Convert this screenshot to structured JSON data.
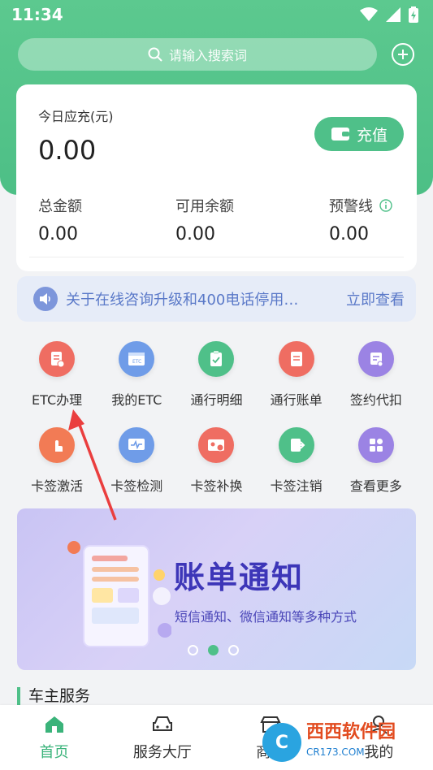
{
  "status": {
    "time": "11:34"
  },
  "search": {
    "placeholder": "请输入搜索词"
  },
  "balance_card": {
    "today_label": "今日应充(元)",
    "today_amount": "0.00",
    "recharge_label": "充值",
    "stats": [
      {
        "label": "总金额",
        "value": "0.00"
      },
      {
        "label": "可用余额",
        "value": "0.00"
      },
      {
        "label": "预警线",
        "value": "0.00"
      }
    ]
  },
  "notice": {
    "text": "关于在线咨询升级和400电话停用…",
    "link": "立即查看"
  },
  "services": [
    {
      "label": "ETC办理",
      "icon": "doc-clock-icon",
      "color": "#ef6d62"
    },
    {
      "label": "我的ETC",
      "icon": "etc-card-icon",
      "color": "#6f9ce8"
    },
    {
      "label": "通行明细",
      "icon": "clipboard-icon",
      "color": "#4fc089"
    },
    {
      "label": "通行账单",
      "icon": "bill-icon",
      "color": "#ef6d62"
    },
    {
      "label": "签约代扣",
      "icon": "sign-icon",
      "color": "#9b83e4"
    },
    {
      "label": "卡签激活",
      "icon": "tap-icon",
      "color": "#f27b55"
    },
    {
      "label": "卡签检测",
      "icon": "monitor-icon",
      "color": "#6f9ce8"
    },
    {
      "label": "卡签补换",
      "icon": "card-swap-icon",
      "color": "#ef6d62"
    },
    {
      "label": "卡签注销",
      "icon": "logout-icon",
      "color": "#4fc089"
    },
    {
      "label": "查看更多",
      "icon": "grid-more-icon",
      "color": "#9b83e4"
    }
  ],
  "banner": {
    "title": "账单通知",
    "subtitle": "短信通知、微信通知等多种方式"
  },
  "section": {
    "title": "车主服务"
  },
  "tabs": [
    {
      "label": "首页",
      "icon": "home-icon"
    },
    {
      "label": "服务大厅",
      "icon": "car-icon"
    },
    {
      "label": "商城",
      "icon": "store-icon"
    },
    {
      "label": "我的",
      "icon": "user-icon"
    }
  ],
  "watermark": {
    "text": "西西软件园",
    "sub": "CR173.COM"
  },
  "colors": {
    "primary": "#4fc089",
    "notice": "#5a79c8",
    "banner_title": "#3d36b8",
    "watermark": "#e24b1f"
  }
}
